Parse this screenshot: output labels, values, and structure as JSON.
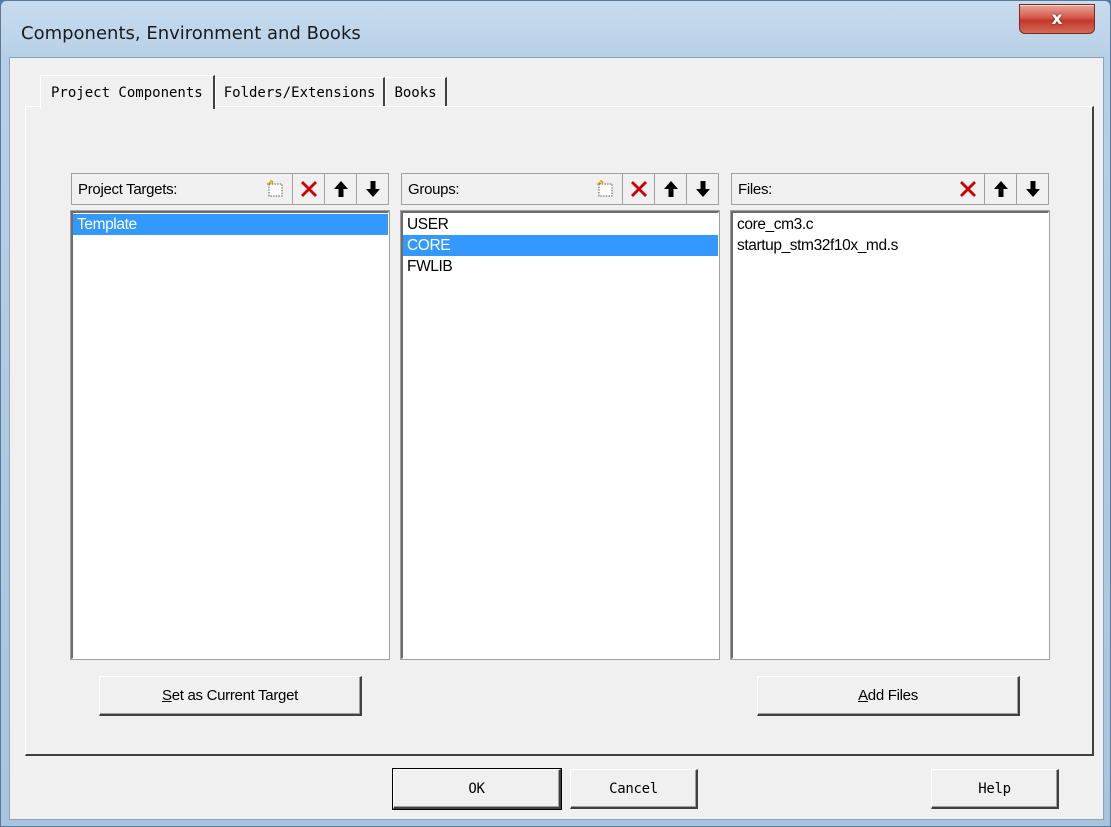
{
  "window": {
    "title": "Components, Environment and Books",
    "close_glyph": "x"
  },
  "tabs": [
    {
      "label": "Project Components",
      "active": true
    },
    {
      "label": "Folders/Extensions",
      "active": false
    },
    {
      "label": "Books",
      "active": false
    }
  ],
  "targets": {
    "title": "Project Targets:",
    "items": [
      {
        "label": "Template",
        "selected": true
      }
    ],
    "tools": [
      "new-item-icon",
      "delete-icon",
      "move-up-icon",
      "move-down-icon"
    ]
  },
  "groups": {
    "title": "Groups:",
    "items": [
      {
        "label": "USER",
        "selected": false
      },
      {
        "label": "CORE",
        "selected": true
      },
      {
        "label": "FWLIB",
        "selected": false
      }
    ],
    "tools": [
      "new-item-icon",
      "delete-icon",
      "move-up-icon",
      "move-down-icon"
    ]
  },
  "files": {
    "title": "Files:",
    "items": [
      {
        "label": "core_cm3.c",
        "selected": false
      },
      {
        "label": "startup_stm32f10x_md.s",
        "selected": false
      }
    ],
    "tools": [
      "delete-icon",
      "move-up-icon",
      "move-down-icon"
    ]
  },
  "buttons": {
    "set_target": {
      "accel": "S",
      "rest": "et as Current Target"
    },
    "add_files": {
      "accel": "A",
      "rest": "dd Files"
    },
    "ok": "OK",
    "cancel": "Cancel",
    "help": "Help"
  },
  "colors": {
    "selection": "#3399ff",
    "delete_icon": "#cc0000"
  }
}
